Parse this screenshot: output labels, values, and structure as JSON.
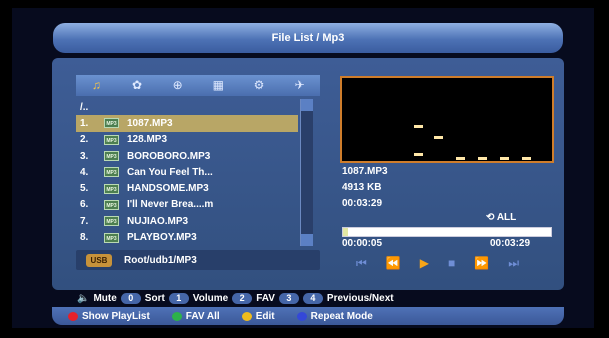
{
  "title": "File List / Mp3",
  "tabs": [
    {
      "icon": "music-folder-icon"
    },
    {
      "icon": "photo-icon"
    },
    {
      "icon": "satellite-icon"
    },
    {
      "icon": "film-icon"
    },
    {
      "icon": "settings-icon"
    },
    {
      "icon": "airplane-icon"
    }
  ],
  "files": [
    {
      "num": "",
      "name": "/.."
    },
    {
      "num": "1.",
      "name": "1087.MP3",
      "type": "MP3"
    },
    {
      "num": "2.",
      "name": "128.MP3",
      "type": "MP3"
    },
    {
      "num": "3.",
      "name": "BOROBORO.MP3",
      "type": "MP3"
    },
    {
      "num": "4.",
      "name": "Can You Feel Th...",
      "type": "MP3"
    },
    {
      "num": "5.",
      "name": "HANDSOME.MP3",
      "type": "MP3"
    },
    {
      "num": "6.",
      "name": "I'll Never Brea....m",
      "type": "MP3"
    },
    {
      "num": "7.",
      "name": "NUJIAO.MP3",
      "type": "MP3"
    },
    {
      "num": "8.",
      "name": "PLAYBOY.MP3",
      "type": "MP3"
    }
  ],
  "path": {
    "usb_label": "USB",
    "text": "Root/udb1/MP3"
  },
  "now_playing": {
    "file": "1087.MP3",
    "size": "4913 KB",
    "duration": "00:03:29",
    "repeat": "ALL",
    "elapsed": "00:00:05",
    "total": "00:03:29",
    "progress": 0.024
  },
  "controls": [
    "⏮",
    "⏪",
    "▶",
    "■",
    "⏩",
    "⏭"
  ],
  "help": {
    "mute": "Mute",
    "k0": "0",
    "sort": "Sort",
    "k1": "1",
    "volume": "Volume",
    "k2": "2",
    "fav": "FAV",
    "k3": "3",
    "k4": "4",
    "prevnext": "Previous/Next"
  },
  "colorkeys": [
    {
      "color": "#e5212a",
      "label": "Show PlayList"
    },
    {
      "color": "#2db24a",
      "label": "FAV All"
    },
    {
      "color": "#f0bc1d",
      "label": "Edit"
    },
    {
      "color": "#3448d8",
      "label": "Repeat Mode"
    }
  ]
}
